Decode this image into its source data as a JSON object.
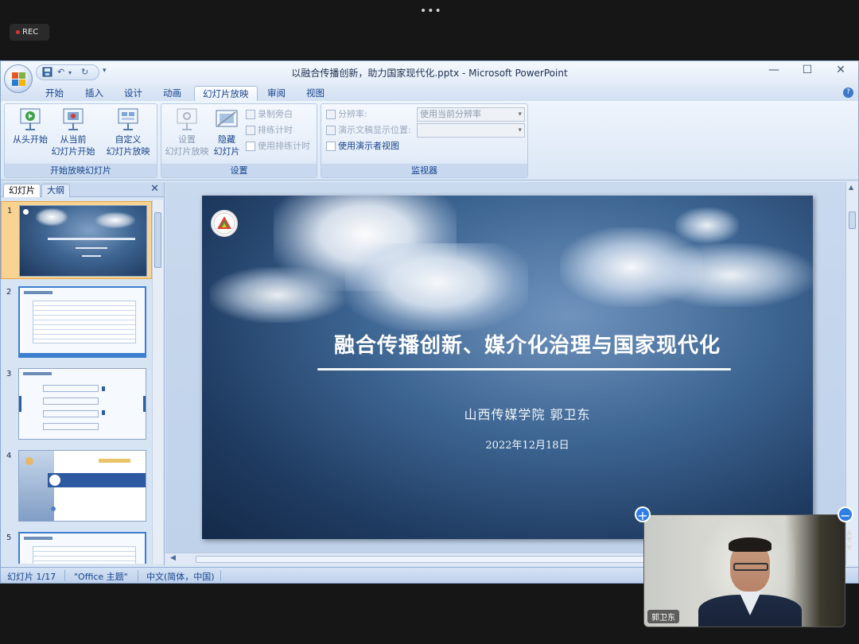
{
  "meeting": {
    "menu_dots": "•••",
    "rec_label": "REC"
  },
  "window": {
    "title": "以融合传播创新，助力国家现代化.pptx - Microsoft PowerPoint",
    "minimize": "—",
    "maximize": "☐",
    "close": "✕"
  },
  "qat": {
    "save_icon": "save-icon",
    "undo_icon": "undo-icon",
    "redo_icon": "redo-icon",
    "more": "▾"
  },
  "ribbon": {
    "tabs": [
      "开始",
      "插入",
      "设计",
      "动画",
      "幻灯片放映",
      "审阅",
      "视图"
    ],
    "active_tab": "幻灯片放映",
    "help": "?",
    "group1": {
      "label": "开始放映幻灯片",
      "from_beginning": "从头开始",
      "from_current_1": "从当前",
      "from_current_2": "幻灯片开始",
      "custom_1": "自定义",
      "custom_2": "幻灯片放映"
    },
    "group2": {
      "label": "设置",
      "setup_1": "设置",
      "setup_2": "幻灯片放映",
      "hide_1": "隐藏",
      "hide_2": "幻灯片",
      "record_narration": "录制旁白",
      "rehearse_timings": "排练计时",
      "use_rehearsed": "使用排练计时"
    },
    "group3": {
      "label": "监视器",
      "resolution_label": "分辨率:",
      "resolution_value": "使用当前分辨率",
      "show_on_label": "演示文稿显示位置:",
      "show_on_value": "",
      "presenter_view": "使用演示者视图"
    }
  },
  "left_pane": {
    "tab_slides": "幻灯片",
    "tab_outline": "大纲",
    "close": "✕",
    "slide_numbers": [
      "1",
      "2",
      "3",
      "4",
      "5"
    ]
  },
  "slide": {
    "title": "融合传播创新、媒介化治理与国家现代化",
    "subtitle": "山西传媒学院  郭卫东",
    "date": "2022年12月18日"
  },
  "status": {
    "slide_indicator": "幻灯片 1/17",
    "theme": "\"Office 主题\"",
    "language": "中文(简体，中国)"
  },
  "video": {
    "participant_name": "郭卫东",
    "add_button": "+",
    "minus_button": "−"
  },
  "colors": {
    "ribbon_text": "#15428b",
    "selected_thumb": "#f9d391",
    "slide_bg": "#2d4e78",
    "video_button": "#2f7ee6"
  }
}
